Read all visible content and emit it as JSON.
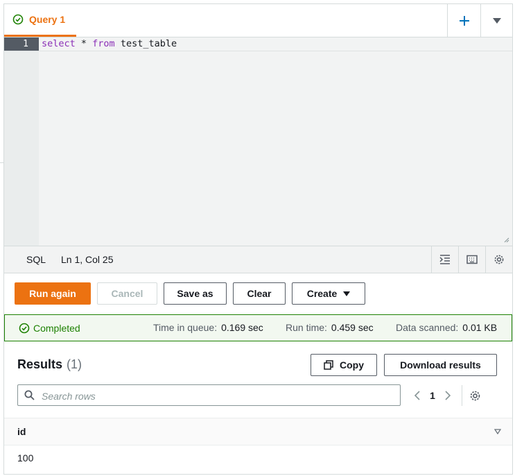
{
  "tabs": {
    "active_label": "Query 1"
  },
  "editor": {
    "line_number": "1",
    "code": {
      "kw1": "select",
      "mid": " * ",
      "kw2": "from",
      "rest": " test_table"
    }
  },
  "statusbar": {
    "language": "SQL",
    "cursor": "Ln 1, Col 25"
  },
  "actions": {
    "run_again": "Run again",
    "cancel": "Cancel",
    "save_as": "Save as",
    "clear": "Clear",
    "create": "Create"
  },
  "banner": {
    "status": "Completed",
    "queue_label": "Time in queue:",
    "queue_value": "0.169 sec",
    "run_label": "Run time:",
    "run_value": "0.459 sec",
    "scan_label": "Data scanned:",
    "scan_value": "0.01 KB"
  },
  "results": {
    "title": "Results",
    "count": "(1)",
    "copy": "Copy",
    "download": "Download results",
    "search_placeholder": "Search rows",
    "page": "1",
    "columns": [
      "id"
    ],
    "rows": [
      [
        "100"
      ]
    ]
  },
  "colors": {
    "accent": "#ec7211",
    "success": "#1d8102"
  }
}
